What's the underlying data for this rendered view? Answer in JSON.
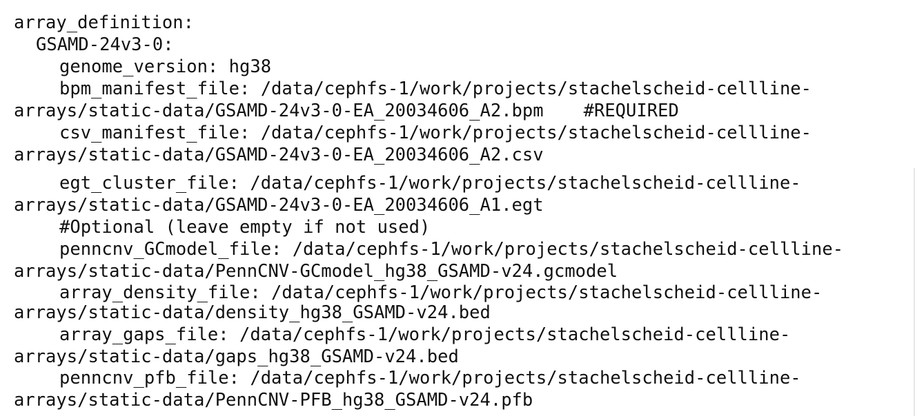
{
  "document": {
    "lines": [
      "array_definition:",
      "GSAMD-24v3-0:",
      "genome_version: hg38",
      "bpm_manifest_file: /data/cephfs-1/work/projects/stachelscheid-cellline-",
      "arrays/static-data/GSAMD-24v3-0-EA_20034606_A2.bpm",
      "#REQUIRED",
      "csv_manifest_file: /data/cephfs-1/work/projects/stachelscheid-cellline-",
      "arrays/static-data/GSAMD-24v3-0-EA_20034606_A2.csv",
      "egt_cluster_file: /data/cephfs-1/work/projects/stachelscheid-cellline-",
      "arrays/static-data/GSAMD-24v3-0-EA_20034606_A1.egt",
      "#Optional (leave empty if not used)",
      "penncnv_GCmodel_file: /data/cephfs-1/work/projects/stachelscheid-cellline-",
      "arrays/static-data/PennCNV-GCmodel_hg38_GSAMD-v24.gcmodel",
      "array_density_file: /data/cephfs-1/work/projects/stachelscheid-cellline-",
      "arrays/static-data/density_hg38_GSAMD-v24.bed",
      "array_gaps_file: /data/cephfs-1/work/projects/stachelscheid-cellline-",
      "arrays/static-data/gaps_hg38_GSAMD-v24.bed",
      "penncnv_pfb_file: /data/cephfs-1/work/projects/stachelscheid-cellline-",
      "arrays/static-data/PennCNV-PFB_hg38_GSAMD-v24.pfb"
    ]
  }
}
